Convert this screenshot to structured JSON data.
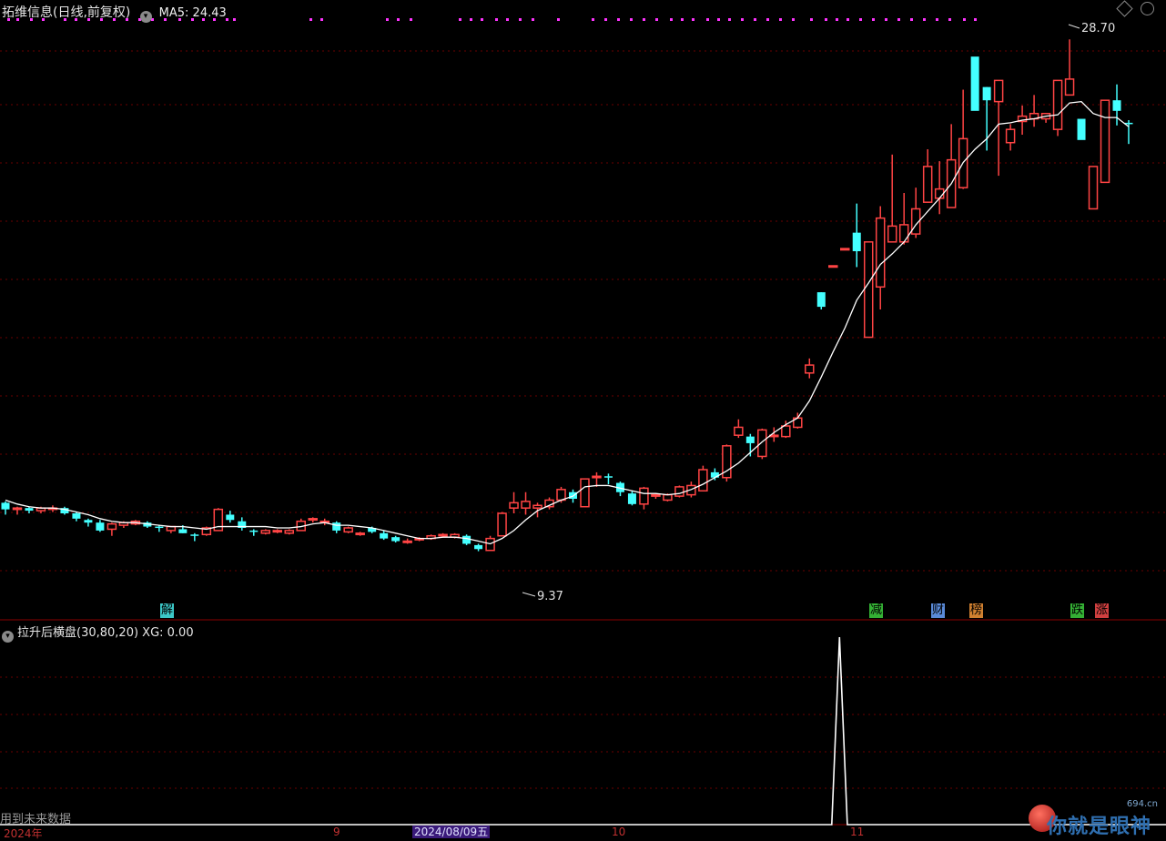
{
  "header": {
    "title": "拓维信息(日线,前复权)",
    "ma_label": "MA5: 24.43"
  },
  "sub_header": {
    "title": "拉升后横盘(30,80,20) XG: 0.00"
  },
  "annotations": {
    "high": "28.70",
    "low": "9.37"
  },
  "events": [
    {
      "label": "解",
      "color": "#3cc8c8"
    },
    {
      "label": "减",
      "color": "#34b034"
    },
    {
      "label": "财",
      "color": "#5a8ad8"
    },
    {
      "label": "榜",
      "color": "#d08030"
    },
    {
      "label": "跌",
      "color": "#34b034"
    },
    {
      "label": "涨",
      "color": "#d04040"
    }
  ],
  "footer": {
    "note": "用到未来数据",
    "axis_labels": [
      "2024年",
      "9",
      "10",
      "11"
    ],
    "date_highlight": "2024/08/09五"
  },
  "watermark": {
    "site": "694.cn",
    "text": "你就是眼神"
  },
  "colors": {
    "up": "#ff4444",
    "down": "#44ffff",
    "ma": "#ffffff",
    "grid": "#6a0000",
    "signal": "#ff33ff"
  },
  "chart_data": [
    {
      "type": "candlestick",
      "title": "拓维信息(日线,前复权)",
      "ylim": [
        7.5,
        29.5
      ],
      "ohlc": [
        [
          11.2,
          11.25,
          10.75,
          10.95
        ],
        [
          10.95,
          11.05,
          10.75,
          11.0
        ],
        [
          11.0,
          11.05,
          10.8,
          10.9
        ],
        [
          10.9,
          11.05,
          10.8,
          11.0
        ],
        [
          10.95,
          11.1,
          10.85,
          11.0
        ],
        [
          11.0,
          11.05,
          10.75,
          10.8
        ],
        [
          10.8,
          10.85,
          10.5,
          10.6
        ],
        [
          10.55,
          10.6,
          10.3,
          10.45
        ],
        [
          10.45,
          10.55,
          10.1,
          10.15
        ],
        [
          10.2,
          10.45,
          9.95,
          10.4
        ],
        [
          10.35,
          10.5,
          10.25,
          10.45
        ],
        [
          10.4,
          10.55,
          10.35,
          10.5
        ],
        [
          10.45,
          10.5,
          10.25,
          10.3
        ],
        [
          10.3,
          10.35,
          10.1,
          10.25
        ],
        [
          10.15,
          10.3,
          10.05,
          10.3
        ],
        [
          10.2,
          10.35,
          10.05,
          10.05
        ],
        [
          10.0,
          10.05,
          9.75,
          9.95
        ],
        [
          10.0,
          10.3,
          9.95,
          10.25
        ],
        [
          10.15,
          11.0,
          10.15,
          10.95
        ],
        [
          10.75,
          10.9,
          10.45,
          10.55
        ],
        [
          10.5,
          10.65,
          10.15,
          10.25
        ],
        [
          10.15,
          10.2,
          9.95,
          10.1
        ],
        [
          10.05,
          10.2,
          10.0,
          10.15
        ],
        [
          10.1,
          10.2,
          10.05,
          10.15
        ],
        [
          10.05,
          10.2,
          10.0,
          10.15
        ],
        [
          10.15,
          10.6,
          10.15,
          10.5
        ],
        [
          10.55,
          10.65,
          10.45,
          10.6
        ],
        [
          10.45,
          10.6,
          10.35,
          10.5
        ],
        [
          10.45,
          10.5,
          10.05,
          10.15
        ],
        [
          10.1,
          10.3,
          10.05,
          10.25
        ],
        [
          10.05,
          10.1,
          9.95,
          10.05
        ],
        [
          10.25,
          10.3,
          10.05,
          10.1
        ],
        [
          10.05,
          10.15,
          9.8,
          9.85
        ],
        [
          9.9,
          9.95,
          9.7,
          9.75
        ],
        [
          9.75,
          9.85,
          9.65,
          9.75
        ],
        [
          9.8,
          9.9,
          9.75,
          9.85
        ],
        [
          9.85,
          10.0,
          9.8,
          9.95
        ],
        [
          9.95,
          10.05,
          9.9,
          10.0
        ],
        [
          9.9,
          10.05,
          9.85,
          10.0
        ],
        [
          9.95,
          10.0,
          9.6,
          9.65
        ],
        [
          9.6,
          9.65,
          9.37,
          9.45
        ],
        [
          9.4,
          9.95,
          9.4,
          9.85
        ],
        [
          9.95,
          10.85,
          9.95,
          10.8
        ],
        [
          11.0,
          11.6,
          10.8,
          11.2
        ],
        [
          11.0,
          11.6,
          10.75,
          11.25
        ],
        [
          11.0,
          11.2,
          10.65,
          11.1
        ],
        [
          11.05,
          11.4,
          10.95,
          11.3
        ],
        [
          11.3,
          11.8,
          11.2,
          11.7
        ],
        [
          11.6,
          11.7,
          11.2,
          11.35
        ],
        [
          11.05,
          12.1,
          11.05,
          12.1
        ],
        [
          12.2,
          12.35,
          11.8,
          12.2
        ],
        [
          12.2,
          12.3,
          11.9,
          12.15
        ],
        [
          11.95,
          12.0,
          11.45,
          11.6
        ],
        [
          11.55,
          11.65,
          11.1,
          11.15
        ],
        [
          11.15,
          11.8,
          10.95,
          11.75
        ],
        [
          11.45,
          11.55,
          11.35,
          11.5
        ],
        [
          11.3,
          11.55,
          11.25,
          11.5
        ],
        [
          11.45,
          11.85,
          11.4,
          11.8
        ],
        [
          11.5,
          12.0,
          11.4,
          11.85
        ],
        [
          11.65,
          12.6,
          11.65,
          12.45
        ],
        [
          12.35,
          12.5,
          12.05,
          12.15
        ],
        [
          12.15,
          13.4,
          12.0,
          13.35
        ],
        [
          13.75,
          14.35,
          13.65,
          14.05
        ],
        [
          13.7,
          13.8,
          12.95,
          13.45
        ],
        [
          12.95,
          14.0,
          12.85,
          13.95
        ],
        [
          13.7,
          14.05,
          13.5,
          13.75
        ],
        [
          13.7,
          14.3,
          13.65,
          14.1
        ],
        [
          14.05,
          14.6,
          14.0,
          14.4
        ],
        [
          16.1,
          16.65,
          15.9,
          16.4
        ],
        [
          19.15,
          19.15,
          18.5,
          18.6
        ],
        [
          20.15,
          20.15,
          20.15,
          20.15
        ],
        [
          20.8,
          20.8,
          20.8,
          20.8
        ],
        [
          21.4,
          22.5,
          20.1,
          20.7
        ],
        [
          17.45,
          20.9,
          17.45,
          21.05
        ],
        [
          19.35,
          22.4,
          18.5,
          21.95
        ],
        [
          21.05,
          24.35,
          21.05,
          21.65
        ],
        [
          21.05,
          22.9,
          20.95,
          21.7
        ],
        [
          21.35,
          23.1,
          21.2,
          22.3
        ],
        [
          22.55,
          24.55,
          22.55,
          23.9
        ],
        [
          22.7,
          24.1,
          22.1,
          23.05
        ],
        [
          22.35,
          25.5,
          22.35,
          24.15
        ],
        [
          23.1,
          26.8,
          23.05,
          24.95
        ],
        [
          28.05,
          26.0,
          26.0,
          26.0
        ],
        [
          26.9,
          26.9,
          24.5,
          26.4
        ],
        [
          26.35,
          26.35,
          23.55,
          27.15
        ],
        [
          24.8,
          25.5,
          24.5,
          25.3
        ],
        [
          25.6,
          26.2,
          25.1,
          25.8
        ],
        [
          25.7,
          26.6,
          25.4,
          25.9
        ],
        [
          25.7,
          25.85,
          25.55,
          25.9
        ],
        [
          25.3,
          26.4,
          25.05,
          27.15
        ],
        [
          26.6,
          28.7,
          26.6,
          27.2
        ],
        [
          25.7,
          25.7,
          25.7,
          24.9
        ],
        [
          22.3,
          23.85,
          22.3,
          23.9
        ],
        [
          23.3,
          26.4,
          23.7,
          26.4
        ],
        [
          26.4,
          27.0,
          25.45,
          26.0
        ],
        [
          25.55,
          25.65,
          24.75,
          25.5
        ]
      ],
      "ma5": [
        11.3,
        11.15,
        11.05,
        11.0,
        11.0,
        10.95,
        10.85,
        10.75,
        10.6,
        10.5,
        10.45,
        10.45,
        10.4,
        10.35,
        10.3,
        10.3,
        10.25,
        10.2,
        10.3,
        10.3,
        10.3,
        10.3,
        10.3,
        10.25,
        10.25,
        10.3,
        10.4,
        10.45,
        10.35,
        10.35,
        10.3,
        10.25,
        10.15,
        10.05,
        9.95,
        9.85,
        9.85,
        9.9,
        9.9,
        9.85,
        9.75,
        9.65,
        9.85,
        10.15,
        10.55,
        10.9,
        11.1,
        11.3,
        11.45,
        11.8,
        11.85,
        11.85,
        11.75,
        11.65,
        11.55,
        11.55,
        11.5,
        11.55,
        11.7,
        11.9,
        12.15,
        12.4,
        12.7,
        13.1,
        13.5,
        13.85,
        14.15,
        14.4,
        15.05,
        15.95,
        16.9,
        17.8,
        18.85,
        19.5,
        20.2,
        20.6,
        21.05,
        21.7,
        22.2,
        22.7,
        23.25,
        24.05,
        24.55,
        24.95,
        25.5,
        25.55,
        25.65,
        25.7,
        25.8,
        25.85,
        26.3,
        26.35,
        25.9,
        25.75,
        25.75,
        25.4
      ]
    },
    {
      "type": "line",
      "title": "拉升后横盘(30,80,20) XG: 0.00",
      "ylim": [
        0,
        1
      ],
      "values": [
        0,
        0,
        0,
        0,
        0,
        0,
        0,
        0,
        0,
        0,
        0,
        0,
        0,
        0,
        0,
        0,
        0,
        0,
        0,
        0,
        0,
        0,
        0,
        0,
        0,
        0,
        0,
        0,
        0,
        0,
        0,
        0,
        0,
        0,
        0,
        0,
        0,
        0,
        0,
        0,
        0,
        0,
        0,
        0,
        0,
        0,
        0,
        0,
        0,
        0,
        0,
        0,
        0,
        0,
        0,
        0,
        0,
        0,
        0,
        0,
        0,
        0,
        0,
        0,
        0,
        0,
        0,
        0,
        0,
        0,
        0,
        0,
        0,
        0,
        0,
        0,
        0,
        0,
        0,
        0,
        0,
        0,
        0,
        0,
        0,
        0,
        0,
        0,
        0,
        0,
        0,
        0,
        0,
        0,
        0,
        0,
        0,
        0,
        0,
        0,
        0,
        0,
        0,
        0,
        0,
        0,
        0,
        0,
        1,
        0,
        0,
        0,
        0,
        0,
        0,
        0,
        0,
        0,
        0,
        0,
        0,
        0,
        0,
        0,
        0,
        0,
        0,
        0,
        0,
        0,
        0,
        0,
        0,
        0,
        0,
        0,
        0,
        0,
        0,
        0,
        0,
        0,
        0,
        0,
        0,
        0,
        0,
        0,
        0,
        0,
        0
      ]
    }
  ]
}
